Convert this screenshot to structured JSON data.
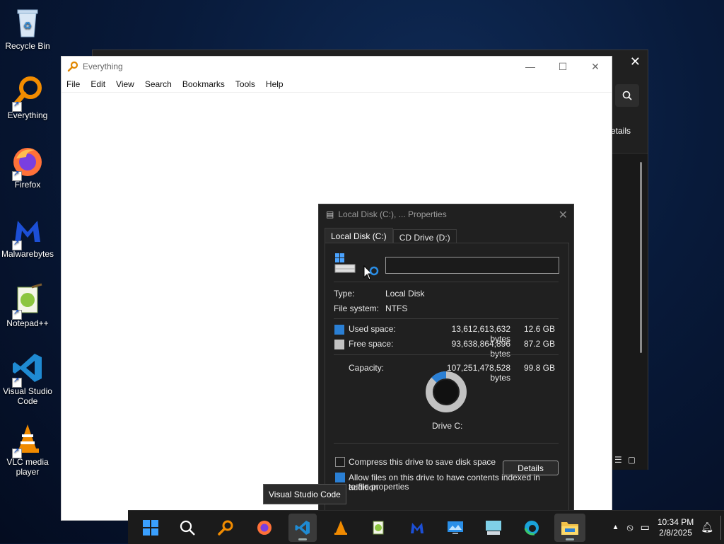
{
  "desktop": {
    "icons": [
      {
        "label": "Recycle Bin"
      },
      {
        "label": "Everything"
      },
      {
        "label": "Firefox"
      },
      {
        "label": "Malwarebytes"
      },
      {
        "label": "Notepad++"
      },
      {
        "label": "Visual Studio Code"
      },
      {
        "label": "VLC media player"
      }
    ]
  },
  "explorer": {
    "details_label": "etails"
  },
  "everything": {
    "title": "Everything",
    "menu": [
      "File",
      "Edit",
      "View",
      "Search",
      "Bookmarks",
      "Tools",
      "Help"
    ]
  },
  "properties": {
    "title": "Local Disk (C:), ... Properties",
    "tabs": [
      "Local Disk (C:)",
      "CD Drive (D:)"
    ],
    "name_value": "",
    "type_label": "Type:",
    "type_value": "Local Disk",
    "fs_label": "File system:",
    "fs_value": "NTFS",
    "used_label": "Used space:",
    "used_bytes": "13,612,613,632 bytes",
    "used_gb": "12.6 GB",
    "free_label": "Free space:",
    "free_bytes": "93,638,864,896 bytes",
    "free_gb": "87.2 GB",
    "capacity_label": "Capacity:",
    "capacity_bytes": "107,251,478,528 bytes",
    "capacity_gb": "99.8 GB",
    "drive_label": "Drive C:",
    "details_button": "Details",
    "compress_label": "Compress this drive to save disk space",
    "index_label_line1": "Allow files on this drive to have contents indexed in addition",
    "index_label_line2": "to file properties",
    "compress_checked": false,
    "index_checked": true,
    "used_fraction": 0.127,
    "colors": {
      "used": "#2a7fd4",
      "free": "#c2c2c2"
    }
  },
  "tooltip": "Visual Studio Code",
  "taskbar": {
    "time": "10:34 PM",
    "date": "2/8/2025",
    "apps": [
      "start-icon",
      "search-icon",
      "everything-icon",
      "firefox-icon",
      "vscode-icon",
      "vlc-icon",
      "notepadpp-icon",
      "malwarebytes-icon",
      "remote-desktop-icon",
      "onscreen-keyboard-icon",
      "edge-icon",
      "file-explorer-icon"
    ]
  }
}
